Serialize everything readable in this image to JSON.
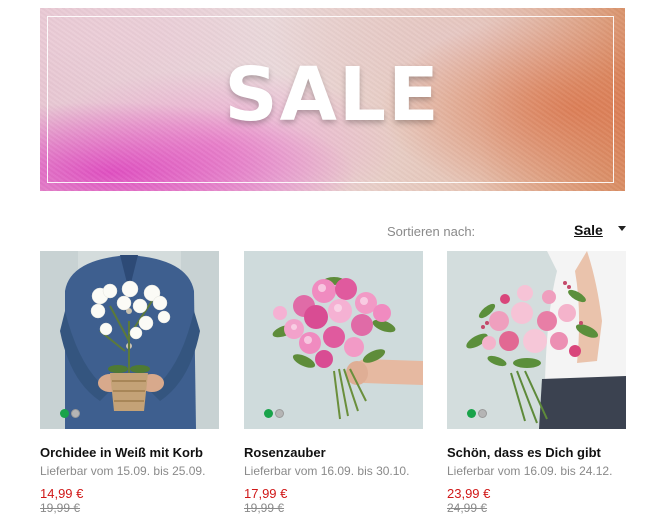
{
  "banner": {
    "title": "SALE"
  },
  "sort": {
    "label": "Sortieren nach:",
    "value": "Sale"
  },
  "products": [
    {
      "name": "Orchidee in Weiß mit Korb",
      "availability": "Lieferbar vom 15.09. bis 25.09.",
      "price": "14,99 €",
      "old_price": "19,99 €"
    },
    {
      "name": "Rosenzauber",
      "availability": "Lieferbar vom 16.09. bis 30.10.",
      "price": "17,99 €",
      "old_price": "19,99 €"
    },
    {
      "name": "Schön, dass es Dich gibt",
      "availability": "Lieferbar vom 16.09. bis 24.12.",
      "price": "23,99 €",
      "old_price": "24,99 €"
    }
  ],
  "colors": {
    "sale_price": "#d01818",
    "active_dot": "#19a34a",
    "muted_text": "#8a8a8a"
  }
}
